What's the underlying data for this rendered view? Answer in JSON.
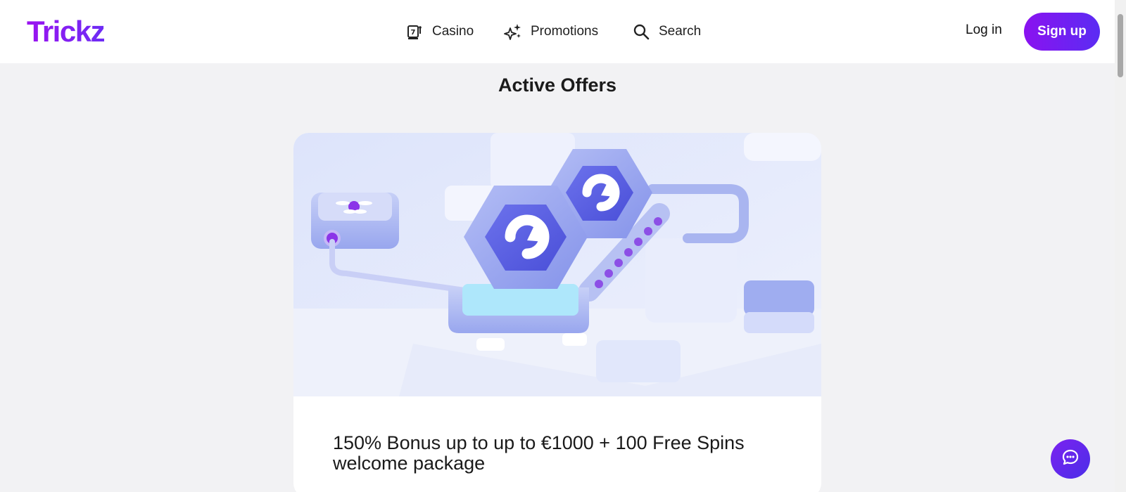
{
  "header": {
    "logo": "Trickz",
    "nav": [
      {
        "label": "Casino",
        "icon": "slot-machine-icon"
      },
      {
        "label": "Promotions",
        "icon": "sparkles-icon"
      },
      {
        "label": "Search",
        "icon": "search-icon"
      }
    ],
    "login_label": "Log in",
    "signup_label": "Sign up"
  },
  "main": {
    "section_title": "Active Offers",
    "offer": {
      "image_icon": "free-spins-illustration",
      "title": "150% Bonus up to up to €1000 + 100 Free Spins welcome package"
    }
  },
  "chat": {
    "icon": "chat-bubble-icon"
  },
  "colors": {
    "brand": "#8a12f0",
    "brand_end": "#5b2cf3",
    "illustration_bg": "#e4e9fb",
    "page_bg": "#f2f2f4"
  }
}
